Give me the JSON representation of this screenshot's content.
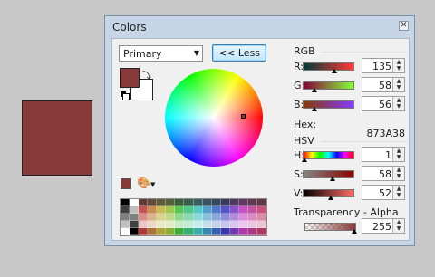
{
  "window": {
    "title": "Colors",
    "close_glyph": "✕"
  },
  "colors": {
    "primary": "#873a38",
    "secondary": "#ffffff",
    "canvas": "#873a38"
  },
  "controls": {
    "mode_select": "Primary",
    "less_button": "<< Less"
  },
  "rgb": {
    "section": "RGB",
    "r_label": "R:",
    "r_value": "135",
    "g_label": "G:",
    "g_value": "58",
    "b_label": "B:",
    "b_value": "56",
    "hex_label": "Hex:",
    "hex_value": "873A38"
  },
  "hsv": {
    "section": "HSV",
    "h_label": "H:",
    "h_value": "1",
    "s_label": "S:",
    "s_value": "58",
    "v_label": "V:",
    "v_value": "52"
  },
  "alpha": {
    "section": "Transparency - Alpha",
    "value": "255"
  },
  "icons": [
    "close-icon",
    "swap-colors-icon",
    "reset-colors-icon",
    "color-picker-icon",
    "palette-menu-icon",
    "dropdown-arrow-icon",
    "spin-up-icon",
    "spin-down-icon"
  ]
}
